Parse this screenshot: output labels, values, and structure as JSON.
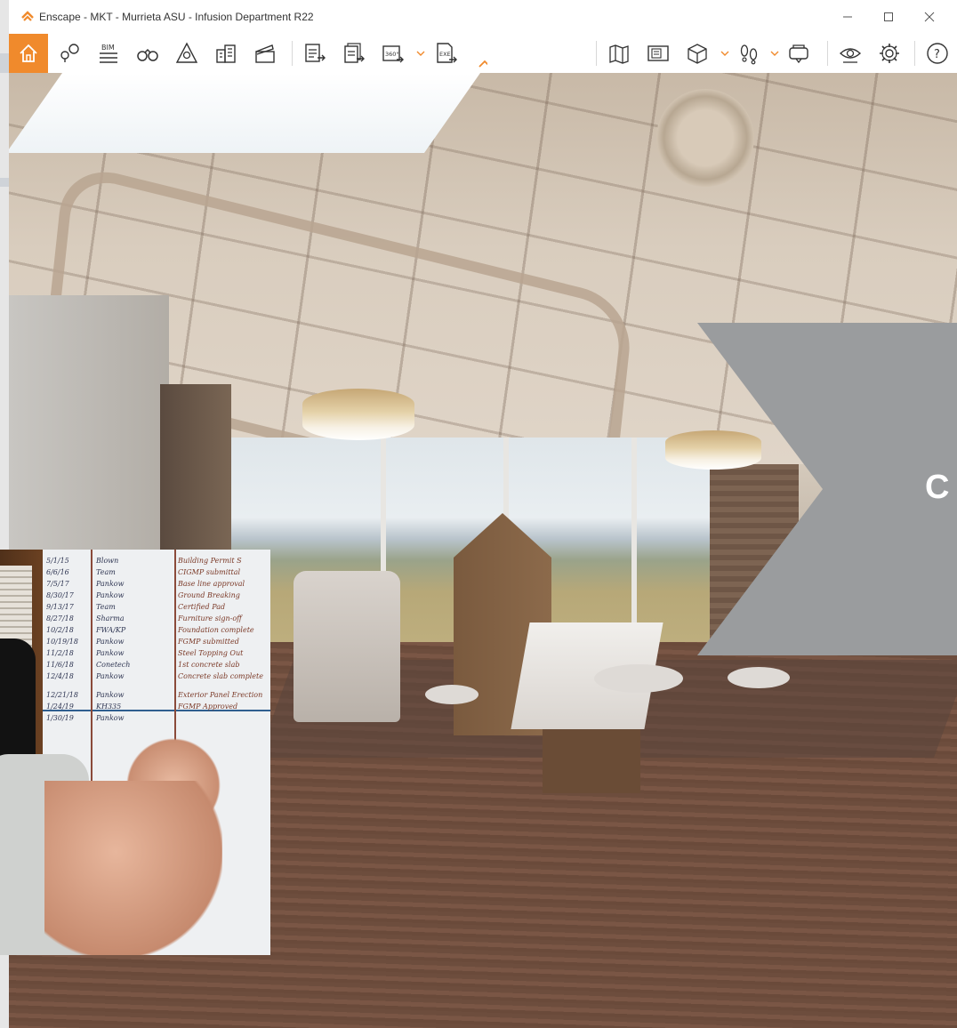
{
  "window": {
    "title": "Enscape - MKT - Murrieta ASU - Infusion Department R22",
    "controls": [
      "minimize",
      "maximize",
      "close"
    ]
  },
  "toolbar": {
    "left_buttons": [
      {
        "name": "home",
        "icon": "home-icon",
        "active": true
      },
      {
        "name": "views",
        "icon": "map-pin-views-icon"
      },
      {
        "name": "bim",
        "icon": "bim-icon",
        "label": "BIM"
      },
      {
        "name": "binoculars",
        "icon": "binoculars-icon"
      },
      {
        "name": "sun",
        "icon": "sun-position-icon"
      },
      {
        "name": "buildings",
        "icon": "buildings-icon"
      },
      {
        "name": "clapper",
        "icon": "video-editor-icon"
      }
    ],
    "export_buttons": [
      {
        "name": "screenshot",
        "icon": "render-screenshot-icon"
      },
      {
        "name": "batch",
        "icon": "batch-render-icon"
      },
      {
        "name": "panorama",
        "icon": "panorama-360-icon",
        "label": "360°"
      },
      {
        "name": "exe",
        "icon": "export-exe-icon",
        "label": "EXE"
      }
    ],
    "collapse_icon": "chevron-up-icon",
    "right_buttons": [
      {
        "name": "map",
        "icon": "map-icon"
      },
      {
        "name": "minimap",
        "icon": "minimap-icon"
      },
      {
        "name": "asset-cube",
        "icon": "cube-icon"
      },
      {
        "name": "footsteps",
        "icon": "footsteps-icon"
      },
      {
        "name": "vr",
        "icon": "vr-headset-icon"
      },
      {
        "name": "visual-settings",
        "icon": "eye-settings-icon"
      },
      {
        "name": "settings",
        "icon": "gear-icon"
      },
      {
        "name": "help",
        "icon": "help-icon"
      }
    ],
    "accent": "#f08a2c"
  },
  "banner": {
    "text": "C",
    "color": "#9a9c9e"
  },
  "whiteboard": {
    "rows": [
      {
        "date": "5/1/15",
        "who": "Blown",
        "task": "Building Permit S"
      },
      {
        "date": "6/6/16",
        "who": "Team",
        "task": "CIGMP submittal"
      },
      {
        "date": "7/5/17",
        "who": "Pankow",
        "task": "Base line approval"
      },
      {
        "date": "8/30/17",
        "who": "Pankow",
        "task": "Ground Breaking"
      },
      {
        "date": "9/13/17",
        "who": "Team",
        "task": "Certified Pad"
      },
      {
        "date": "8/27/18",
        "who": "Sharma",
        "task": "Furniture sign-off"
      },
      {
        "date": "10/2/18",
        "who": "FWA/KP",
        "task": "Foundation complete"
      },
      {
        "date": "10/19/18",
        "who": "Pankow",
        "task": "FGMP submitted"
      },
      {
        "date": "11/2/18",
        "who": "Pankow",
        "task": "Steel Topping Out"
      },
      {
        "date": "11/6/18",
        "who": "Conetech",
        "task": "1st concrete slab"
      },
      {
        "date": "12/4/18",
        "who": "Pankow",
        "task": "Concrete slab complete"
      },
      {
        "date": "12/21/18",
        "who": "Pankow",
        "task": "Exterior Panel Erection"
      },
      {
        "date": "1/24/19",
        "who": "KH335",
        "task": "FGMP Approved"
      },
      {
        "date": "1/30/19",
        "who": "Pankow",
        "task": ""
      }
    ]
  }
}
